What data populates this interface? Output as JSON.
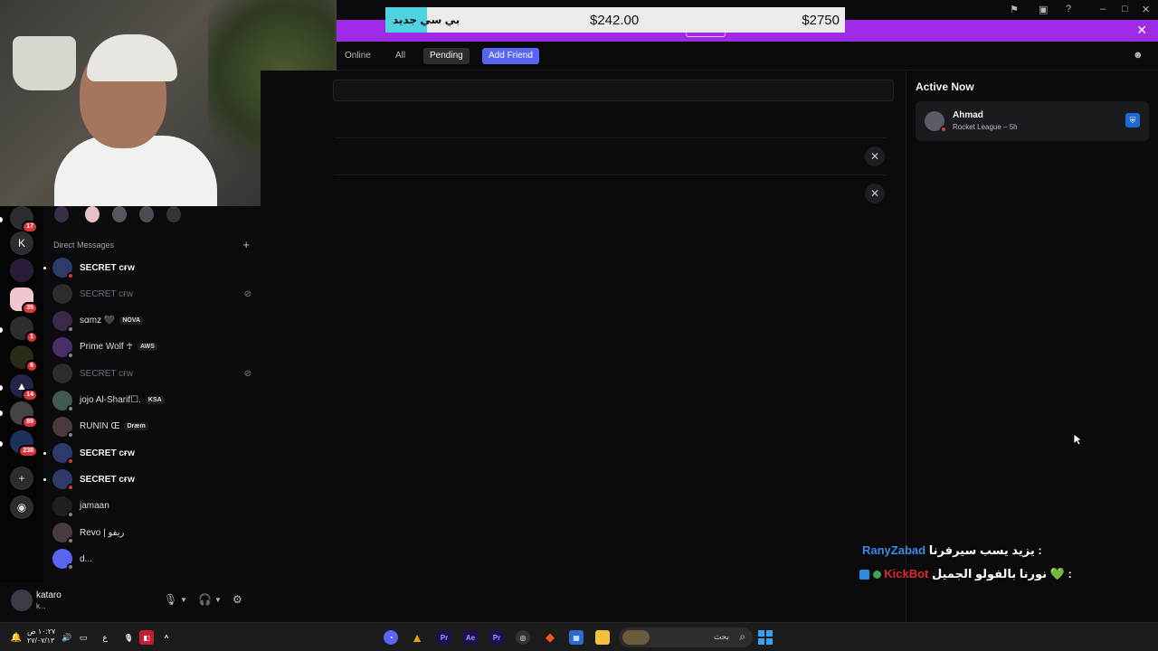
{
  "ticker": {
    "label": "بي سي جديد",
    "price_1": "$242.00",
    "price_2": "$2750"
  },
  "friends_tabs": {
    "online": "Online",
    "all": "All",
    "pending": "Pending",
    "add_friend": "Add Friend"
  },
  "sidebar": {
    "dm_header": "Direct Messages",
    "dms": [
      {
        "name": "SECRET ᴄғᴡ",
        "bold": true,
        "status": "dnd"
      },
      {
        "name": "SECRET ᴄғᴡ",
        "dim": true,
        "status": "none"
      },
      {
        "name": "sαmz 🖤",
        "tag": "NOVA",
        "status": "off"
      },
      {
        "name": "Prime Wolf ☥",
        "tag": "AWS",
        "status": "off"
      },
      {
        "name": "SECRET ᴄғᴡ",
        "dim": true,
        "status": "none"
      },
      {
        "name": "jojo Al-Sharif☐.",
        "tag": "KSA",
        "status": "off"
      },
      {
        "name": "RUNIN Œ",
        "tag": "Dræm",
        "status": "off"
      },
      {
        "name": "SECRET ᴄғᴡ",
        "bold": true,
        "status": "dnd"
      },
      {
        "name": "SECRET ᴄғᴡ",
        "bold": true,
        "status": "dnd"
      },
      {
        "name": "jamaan",
        "status": "off"
      },
      {
        "name": "Revo | ريفو",
        "status": "off"
      },
      {
        "name": "d...",
        "status": "off"
      }
    ]
  },
  "servers": {
    "badges": [
      "17",
      "35",
      "1",
      "6",
      "14",
      "89",
      "238"
    ]
  },
  "user_panel": {
    "username": "kataro",
    "status": "k..."
  },
  "active_now": {
    "title": "Active Now",
    "friend_name": "Ahmad",
    "activity": "Rocket League – 5h"
  },
  "chat_overlay": [
    {
      "user": "RanyZabad",
      "user_color": "#3e8de8",
      "message": "يزيد يسب سيرفرنا :"
    },
    {
      "user": "KickBot",
      "user_color": "#e0282f",
      "message": "نورنا بالفولو الجميل 💚 :"
    }
  ],
  "taskbar": {
    "search_label": "بحث",
    "time": "١٠:٢٧ ص",
    "date": "٢٧/٠٧/١٣",
    "lang": "ع"
  },
  "colors": {
    "banner": "#a02be6",
    "accent": "#5865f2",
    "dnd": "#da373c"
  }
}
